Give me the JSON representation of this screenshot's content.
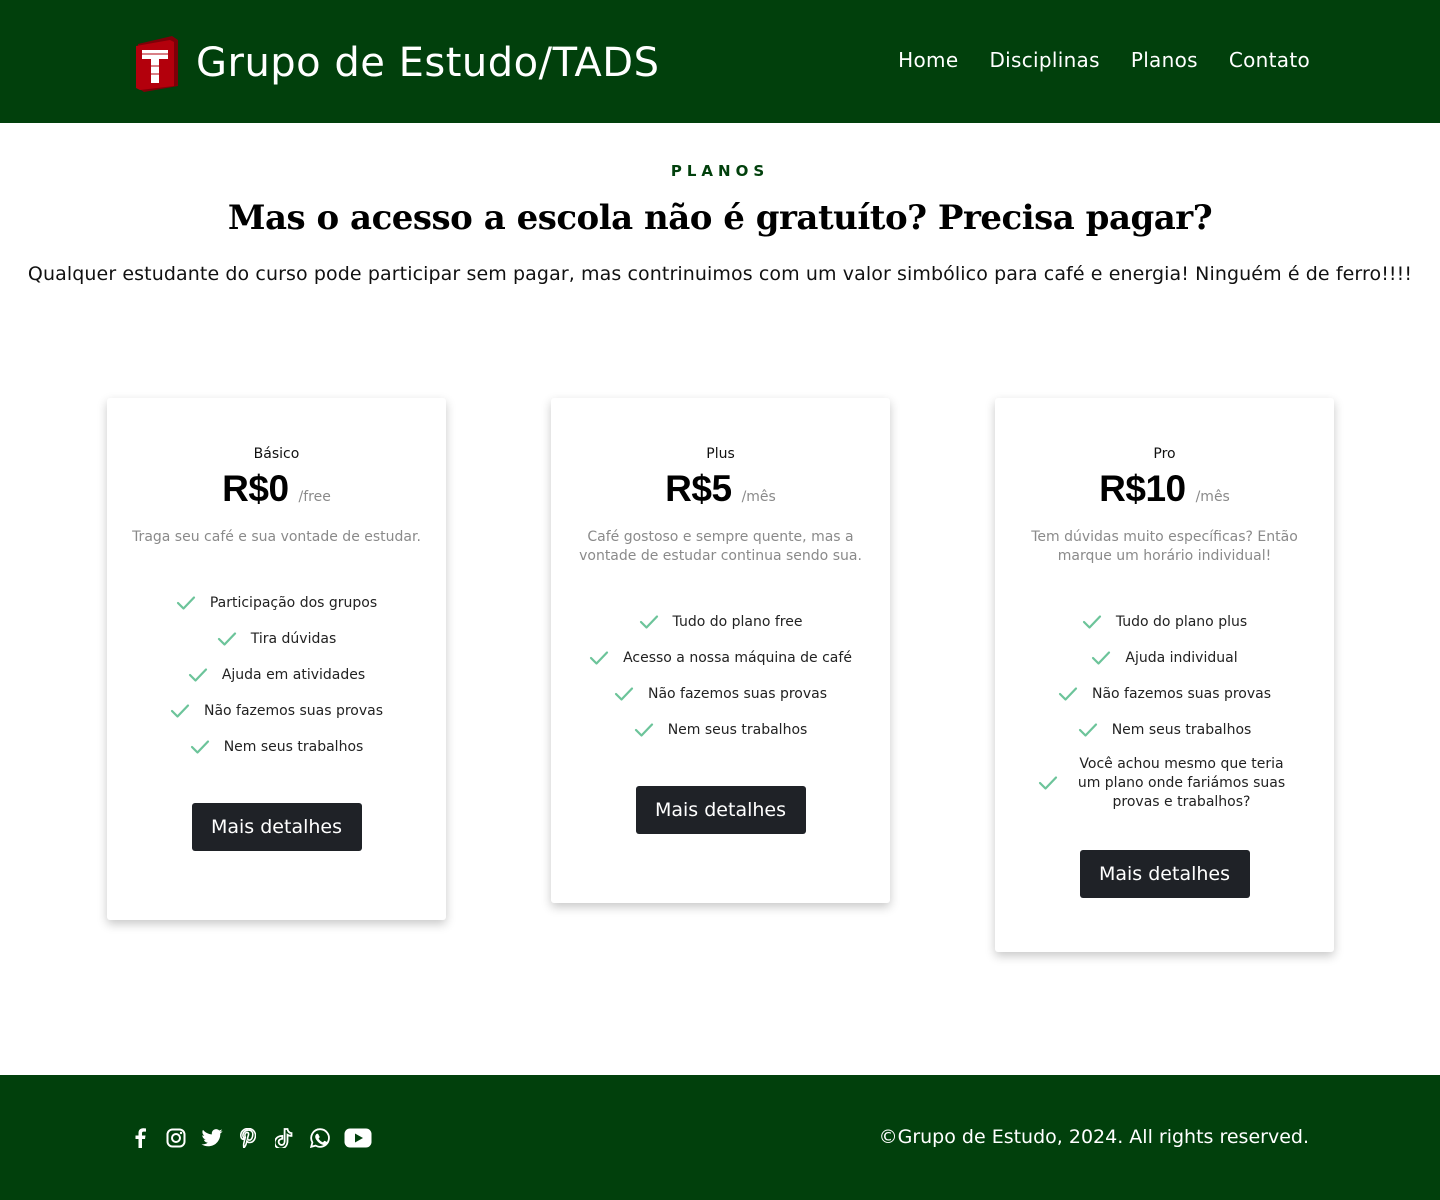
{
  "header": {
    "brand": "Grupo de Estudo/TADS",
    "logo_icon": "tads-logo-icon",
    "nav": [
      "Home",
      "Disciplinas",
      "Planos",
      "Contato"
    ]
  },
  "intro": {
    "eyebrow": "PLANOS",
    "headline": "Mas o acesso a escola não é gratuíto? Precisa pagar?",
    "lead": "Qualquer estudante do curso pode participar sem pagar, mas contrinuimos com um valor simbólico para café e energia! Ninguém é de ferro!!!!"
  },
  "plans": [
    {
      "name": "Básico",
      "price": "R$0",
      "period": "/free",
      "description": "Traga seu café e sua vontade de estudar.",
      "features": [
        "Participação dos grupos",
        "Tira dúvidas",
        "Ajuda em atividades",
        "Não fazemos suas provas",
        "Nem seus trabalhos"
      ],
      "button": "Mais detalhes"
    },
    {
      "name": "Plus",
      "price": "R$5",
      "period": "/mês",
      "description": "Café gostoso e sempre quente, mas a vontade de estudar continua sendo sua.",
      "features": [
        "Tudo do plano free",
        "Acesso a nossa máquina de café",
        "Não fazemos suas provas",
        "Nem seus trabalhos"
      ],
      "button": "Mais detalhes"
    },
    {
      "name": "Pro",
      "price": "R$10",
      "period": "/mês",
      "description": "Tem dúvidas muito específicas? Então marque um horário individual!",
      "features": [
        "Tudo do plano plus",
        "Ajuda individual",
        "Não fazemos suas provas",
        "Nem seus trabalhos",
        "Você achou mesmo que teria um plano onde fariámos suas provas e trabalhos?"
      ],
      "button": "Mais detalhes"
    }
  ],
  "footer": {
    "socials": [
      "facebook-icon",
      "instagram-icon",
      "twitter-icon",
      "pinterest-icon",
      "tiktok-icon",
      "whatsapp-icon",
      "youtube-icon"
    ],
    "copyright": "©Grupo de Estudo, 2024. All rights reserved."
  },
  "colors": {
    "brand_green": "#01400c",
    "check_green": "#6cc49a",
    "button_dark": "#1f2227",
    "logo_red": "#b3000c"
  }
}
